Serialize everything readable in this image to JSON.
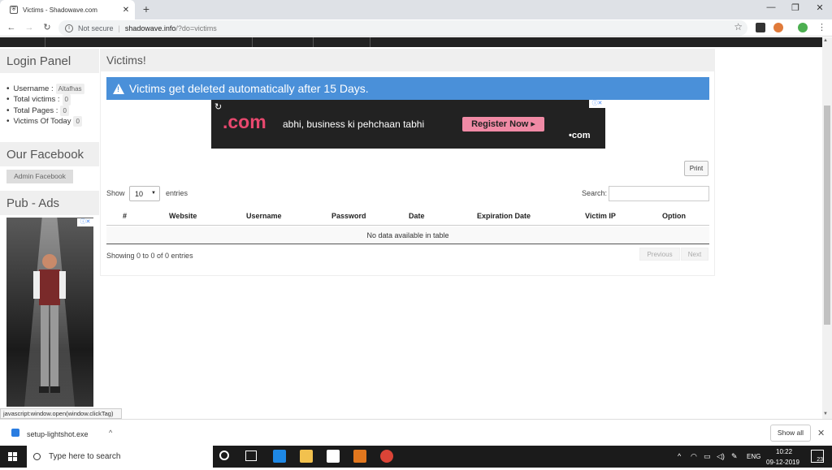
{
  "browser": {
    "tab_title": "Victims - Shadowave.com",
    "new_tab": "+",
    "close_tab": "✕",
    "security": "Not secure",
    "separator": "|",
    "url_host": "shadowave.info",
    "url_path": "/?do=victims"
  },
  "sidebar": {
    "login_heading": "Login Panel",
    "stats": [
      {
        "label": "Username :",
        "value": "Altafhas"
      },
      {
        "label": "Total victims :",
        "value": "0"
      },
      {
        "label": "Total Pages :",
        "value": "0"
      },
      {
        "label": "Victims Of Today",
        "value": "0"
      }
    ],
    "facebook_heading": "Our Facebook",
    "admin_facebook": "Admin Facebook",
    "ads_heading": "Pub - Ads"
  },
  "main": {
    "heading": "Victims!",
    "alert": "Victims get deleted automatically after 15 Days.",
    "banner": {
      "dotcom": ".com",
      "tagline": "abhi, business ki pehchaan tabhi",
      "register": "Register Now ▸",
      "small_dotcom": "•com"
    },
    "print": "Print",
    "show": "Show",
    "page_length": "10",
    "entries": "entries",
    "search_label": "Search:",
    "columns": [
      "#",
      "Website",
      "Username",
      "Password",
      "Date",
      "Expiration Date",
      "Victim IP",
      "Option"
    ],
    "empty": "No data available in table",
    "info": "Showing 0 to 0 of 0 entries",
    "previous": "Previous",
    "next": "Next"
  },
  "status_bar": "javascript:window.open(window.clickTag)",
  "download_bar": {
    "file": "setup-lightshot.exe",
    "show_all": "Show all"
  },
  "taskbar": {
    "search_placeholder": "Type here to search",
    "lang": "ENG",
    "time": "10:22",
    "date": "09-12-2019",
    "notifications": "23"
  },
  "colors": {
    "alert_blue": "#4a90d9",
    "nav_dark": "#222222",
    "register_pink": "#f08aa5"
  }
}
